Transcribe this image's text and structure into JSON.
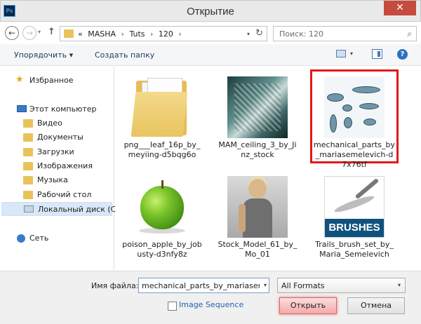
{
  "window": {
    "title": "Открытие",
    "app_icon_text": "Ps",
    "close_symbol": "✕"
  },
  "nav": {
    "address": {
      "prefix": "«",
      "segments": [
        "MASHA",
        "Tuts",
        "120"
      ]
    },
    "search_placeholder": "Поиск: 120"
  },
  "toolbar": {
    "organize_label": "Упорядочить ▾",
    "new_folder_label": "Создать папку",
    "help_symbol": "?"
  },
  "sidebar": {
    "favorites": "Избранное",
    "computer": "Этот компьютер",
    "items": [
      "Видео",
      "Документы",
      "Загрузки",
      "Изображения",
      "Музыка",
      "Рабочий стол",
      "Локальный диск (C"
    ],
    "network": "Сеть"
  },
  "files": [
    {
      "name": "png___leaf_16p_by_meyiing-d5bqg6o",
      "kind": "folder"
    },
    {
      "name": "MAM_ceiling_3_by_Jinz_stock",
      "kind": "image"
    },
    {
      "name": "mechanical_parts_by_mariasemelevich-d7x76tf",
      "kind": "image",
      "selected": true
    },
    {
      "name": "poison_apple_by_jobusty-d3nfy8z",
      "kind": "image"
    },
    {
      "name": "Stock_Model_61_by_Mo_01",
      "kind": "image"
    },
    {
      "name": "Trails_brush_set_by_Maria_Semelevich",
      "kind": "image",
      "badge": "BRUSHES"
    }
  ],
  "footer": {
    "filename_label": "Имя файла:",
    "filename_value": "mechanical_parts_by_mariasem",
    "format_value": "All Formats",
    "image_sequence_label": "Image Sequence",
    "open_label": "Открыть",
    "cancel_label": "Отмена"
  }
}
